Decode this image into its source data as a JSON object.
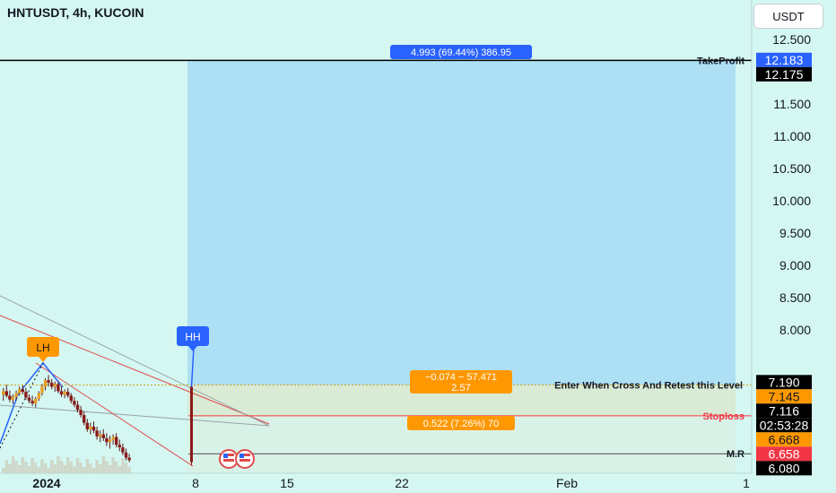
{
  "header": {
    "title": "HNTUSDT, 4h, KUCOIN",
    "currency": "USDT"
  },
  "colors": {
    "background": "#d4f7f2",
    "profit_zone": "#ade0f4",
    "loss_zone": "#d9ebd5",
    "stoploss": "#f23645",
    "orange": "#ff9800",
    "blue_label": "#2962ff"
  },
  "chart_data": {
    "type": "candlestick",
    "symbol": "HNTUSDT",
    "timeframe": "4h",
    "exchange": "KUCOIN",
    "y_axis": {
      "ticks": [
        "12.500",
        "12.000",
        "11.500",
        "11.000",
        "10.500",
        "10.000",
        "9.500",
        "9.000",
        "8.500",
        "8.000"
      ],
      "range": [
        5.9,
        12.6
      ]
    },
    "x_axis": {
      "ticks": [
        "2024",
        "8",
        "15",
        "22",
        "Feb",
        "1"
      ]
    },
    "price_labels": [
      {
        "text": "12.183",
        "value": 12.183,
        "bg": "#2962ff",
        "fg": "#ffffff"
      },
      {
        "text": "12.175",
        "value": 12.175,
        "bg": "#000000",
        "fg": "#ffffff"
      },
      {
        "text": "7.190",
        "value": 7.19,
        "bg": "#000000",
        "fg": "#ffffff"
      },
      {
        "text": "7.145",
        "value": 7.145,
        "bg": "#ff9800",
        "fg": "#131722"
      },
      {
        "text": "7.116",
        "value": 7.116,
        "bg": "#000000",
        "fg": "#ffffff"
      },
      {
        "text": "02:53:28",
        "value": 7.03,
        "bg": "#000000",
        "fg": "#ffffff"
      },
      {
        "text": "6.668",
        "value": 6.668,
        "bg": "#ff9800",
        "fg": "#131722"
      },
      {
        "text": "6.658",
        "value": 6.658,
        "bg": "#f23645",
        "fg": "#ffffff"
      },
      {
        "text": "6.080",
        "value": 6.08,
        "bg": "#000000",
        "fg": "#ffffff"
      }
    ],
    "levels": [
      {
        "name": "TakeProfit",
        "value": 12.175,
        "color": "#000000"
      },
      {
        "name": "Enter When Cross And Retest this Level",
        "value": 7.145,
        "color": "#d4a017"
      },
      {
        "name": "Stoploss",
        "value": 6.668,
        "color": "#f23645"
      },
      {
        "name": "M.R",
        "value": 6.08,
        "color": "#4a4a4a"
      }
    ],
    "position": {
      "entry": 7.145,
      "target": 12.175,
      "stop": 6.668,
      "target_label": "4.993 (69.44%) 386.95",
      "entry_label_line1": "−0.074 − 57.471",
      "entry_label_line2": "2.57",
      "stop_label": "0.522 (7.26%) 70"
    },
    "markers": [
      {
        "text": "LH",
        "value": 7.5,
        "color": "#ff9800"
      },
      {
        "text": "HH",
        "value": 7.75,
        "color": "#2962ff"
      }
    ],
    "candles": [
      [
        7.0,
        7.1,
        6.9,
        7.05
      ],
      [
        7.05,
        7.15,
        6.95,
        6.98
      ],
      [
        6.98,
        7.06,
        6.88,
        6.92
      ],
      [
        6.92,
        7.0,
        6.85,
        6.96
      ],
      [
        6.96,
        7.06,
        6.9,
        7.02
      ],
      [
        7.02,
        7.12,
        6.98,
        7.08
      ],
      [
        7.08,
        7.14,
        7.0,
        7.04
      ],
      [
        7.04,
        7.1,
        6.92,
        6.95
      ],
      [
        6.95,
        7.0,
        6.86,
        6.9
      ],
      [
        6.9,
        6.98,
        6.82,
        6.86
      ],
      [
        6.86,
        6.96,
        6.8,
        6.93
      ],
      [
        6.93,
        7.05,
        6.9,
        7.02
      ],
      [
        7.02,
        7.16,
        6.98,
        7.12
      ],
      [
        7.12,
        7.25,
        7.06,
        7.22
      ],
      [
        7.22,
        7.3,
        7.12,
        7.18
      ],
      [
        7.18,
        7.24,
        7.08,
        7.12
      ],
      [
        7.12,
        7.2,
        7.04,
        7.16
      ],
      [
        7.16,
        7.2,
        7.02,
        7.05
      ],
      [
        7.05,
        7.12,
        6.96,
        7.0
      ],
      [
        7.0,
        7.08,
        6.94,
        7.04
      ],
      [
        7.04,
        7.1,
        6.95,
        6.98
      ],
      [
        6.98,
        7.02,
        6.86,
        6.9
      ],
      [
        6.9,
        6.96,
        6.8,
        6.84
      ],
      [
        6.84,
        6.9,
        6.72,
        6.76
      ],
      [
        6.76,
        6.82,
        6.64,
        6.68
      ],
      [
        6.68,
        6.74,
        6.52,
        6.56
      ],
      [
        6.56,
        6.62,
        6.42,
        6.46
      ],
      [
        6.46,
        6.56,
        6.38,
        6.5
      ],
      [
        6.5,
        6.58,
        6.4,
        6.44
      ],
      [
        6.44,
        6.5,
        6.3,
        6.35
      ],
      [
        6.35,
        6.44,
        6.26,
        6.38
      ],
      [
        6.38,
        6.46,
        6.28,
        6.32
      ],
      [
        6.32,
        6.4,
        6.2,
        6.26
      ],
      [
        6.26,
        6.36,
        6.16,
        6.3
      ],
      [
        6.3,
        6.38,
        6.22,
        6.34
      ],
      [
        6.34,
        6.4,
        6.18,
        6.22
      ],
      [
        6.22,
        6.3,
        6.12,
        6.18
      ],
      [
        6.18,
        6.24,
        6.06,
        6.1
      ],
      [
        6.1,
        6.16,
        5.98,
        6.02
      ],
      [
        6.02,
        6.08,
        5.95,
        5.98
      ]
    ],
    "last_candles": [
      [
        5.95,
        7.18,
        5.9,
        7.12
      ]
    ]
  }
}
